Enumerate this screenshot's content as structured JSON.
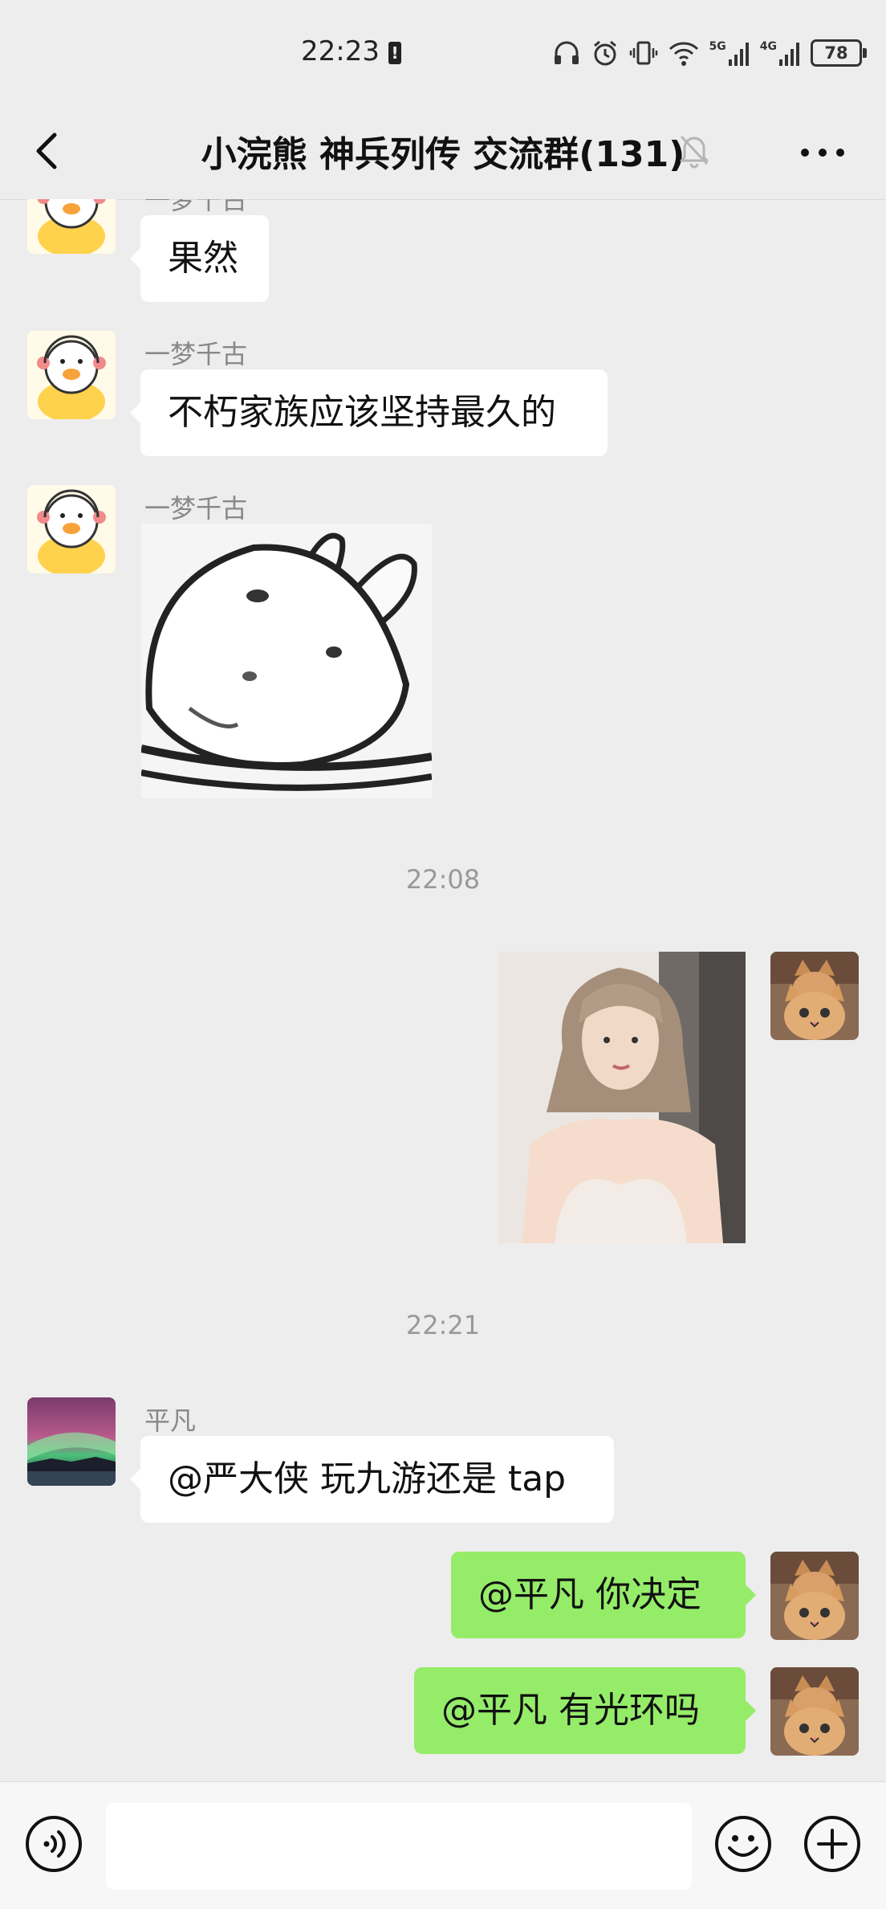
{
  "status_bar": {
    "time": "22:23",
    "battery": "78",
    "net_5g": "5G",
    "net_4g": "4G"
  },
  "header": {
    "title": "小浣熊 神兵列传 交流群(131)"
  },
  "messages": [
    {
      "sender": "一梦千古",
      "text": "果然"
    },
    {
      "sender": "一梦千古",
      "text": "不朽家族应该坚持最久的"
    },
    {
      "sender": "一梦千古"
    },
    {
      "timestamp": "22:08"
    },
    {
      "timestamp": "22:21"
    },
    {
      "sender": "平凡",
      "text": "@严大侠  玩九游还是 tap"
    },
    {
      "text": "@平凡  你决定"
    },
    {
      "text": "@平凡  有光环吗"
    }
  ],
  "colors": {
    "background": "#ededed",
    "bubble_in": "#ffffff",
    "bubble_out": "#95ec69",
    "secondary_text": "#888888"
  },
  "icons": {
    "back": "chevron-left-icon",
    "mute": "bell-off-icon",
    "more": "more-dots-icon",
    "voice": "voice-icon",
    "emoji": "emoji-icon",
    "plus": "plus-circle-icon"
  }
}
